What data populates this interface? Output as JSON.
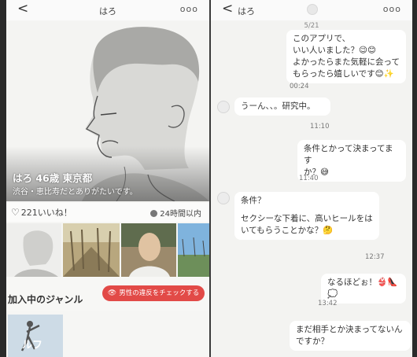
{
  "left_screen": {
    "nav": {
      "back": "<",
      "title": "はろ",
      "more": "ooo"
    },
    "profile": {
      "name_line": "はろ 46歳 東京都",
      "bio": "渋谷・恵比寿だとありがたいです。"
    },
    "stats": {
      "likes": "221いいね！",
      "online": "24時間以内"
    },
    "genre_section": {
      "title": "加入中のジャンル",
      "check_button": "男性の違反をチェックする",
      "genre_label": "ルフ"
    }
  },
  "right_screen": {
    "nav": {
      "back": "<",
      "title": "はろ",
      "more": "ooo"
    },
    "date": "5/21",
    "messages": [
      {
        "from": "me",
        "text_lines": [
          "このアプリで、",
          "いい人いました？😉😊",
          "よかったらまた気軽に会って",
          "もらったら嬉しいです😊✨"
        ],
        "time": "00:24"
      },
      {
        "from": "partner",
        "text_lines": [
          "うーん、、。研究中。"
        ],
        "time": "11:10"
      },
      {
        "from": "me",
        "text_lines": [
          "条件とかって決まってます",
          "か？😅"
        ],
        "time": "11:40"
      },
      {
        "from": "partner",
        "text_lines": [
          "条件？",
          "",
          "セクシーな下着に、高いヒールをは",
          "いてもらうことかな？🤔"
        ],
        "time": "12:37"
      },
      {
        "from": "me",
        "text_lines": [
          "なるほどぉ！👙👠💭"
        ],
        "time": "13:42"
      },
      {
        "from": "partner",
        "text_lines": [
          "まだ相手とか決まってないん",
          "ですか？"
        ],
        "time": ""
      }
    ]
  },
  "colors": {
    "accent_red": "#e24a47",
    "bubble": "#ffffff",
    "background": "#f3f3f1"
  },
  "icons": {
    "back": "chevron-left-icon",
    "more": "more-dots-icon",
    "like": "heart-icon",
    "online": "status-dot-icon",
    "check": "eye-icon"
  }
}
